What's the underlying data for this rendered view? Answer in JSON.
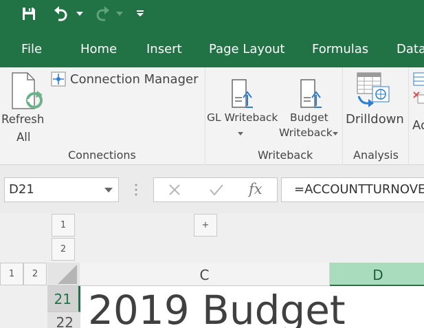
{
  "colors": {
    "brand": "#217346",
    "ribbon_bg": "#f3f3f3",
    "selected_column": "#a8dcbc"
  },
  "quick_access": {
    "icons": [
      "save-icon",
      "undo-icon",
      "redo-icon",
      "customize-icon"
    ]
  },
  "tabs": [
    {
      "label": "File"
    },
    {
      "label": "Home"
    },
    {
      "label": "Insert"
    },
    {
      "label": "Page Layout"
    },
    {
      "label": "Formulas"
    },
    {
      "label": "Data"
    }
  ],
  "ribbon": {
    "connections": {
      "refresh_line1": "Refresh",
      "refresh_line2": "All",
      "connection_manager": "Connection Manager",
      "group_label": "Connections"
    },
    "writeback": {
      "gl_writeback": "GL Writeback",
      "budget_line1": "Budget",
      "budget_line2": "Writeback",
      "group_label": "Writeback"
    },
    "analysis": {
      "drilldown": "Drilldown",
      "group_label": "Analysis"
    },
    "partial_label": "Ac"
  },
  "formula_bar": {
    "name_box": "D21",
    "fx_label": "fx",
    "formula": "=ACCOUNTTURNOVER"
  },
  "outline": {
    "row_levels": [
      "1",
      "2"
    ],
    "col_levels": [
      "1",
      "2"
    ],
    "expand_label": "+"
  },
  "columns": [
    "C",
    "D"
  ],
  "rows": [
    "21",
    "22"
  ],
  "sheet": {
    "title_cell": "2019 Budget"
  }
}
